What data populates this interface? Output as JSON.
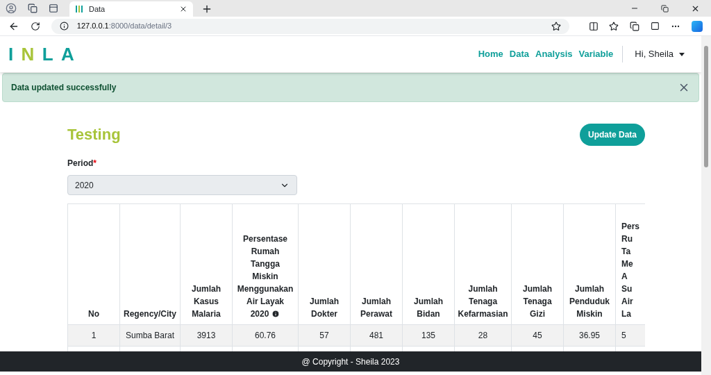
{
  "browser": {
    "tab_title": "Data",
    "url_host": "127.0.0.1",
    "url_path": ":8000/data/detail/3"
  },
  "navbar": {
    "logo": [
      {
        "text": "I",
        "color": "#0f9f9a"
      },
      {
        "text": "N",
        "color": "#a8c43a"
      },
      {
        "text": "L",
        "color": "#0f9f9a"
      },
      {
        "text": "A",
        "color": "#0f9f9a"
      }
    ],
    "links": [
      {
        "label": "Home"
      },
      {
        "label": "Data"
      },
      {
        "label": "Analysis"
      },
      {
        "label": "Variable"
      }
    ],
    "user": "Hi, Sheila"
  },
  "alert": {
    "message": "Data updated successfully",
    "dismissible": true
  },
  "page": {
    "title": "Testing",
    "action": "Update Data",
    "period": {
      "label": "Period",
      "required_mark": "*",
      "value": "2020"
    }
  },
  "table": {
    "columns": [
      {
        "lines": [
          "No"
        ]
      },
      {
        "lines": [
          "Regency/City"
        ]
      },
      {
        "lines": [
          "Jumlah",
          "Kasus",
          "Malaria"
        ]
      },
      {
        "lines": [
          "Persentase",
          "Rumah",
          "Tangga",
          "Miskin",
          "Menggunakan",
          "Air Layak",
          "2020"
        ],
        "info": true
      },
      {
        "lines": [
          "Jumlah",
          "Dokter"
        ]
      },
      {
        "lines": [
          "Jumlah",
          "Perawat"
        ]
      },
      {
        "lines": [
          "Jumlah",
          "Bidan"
        ]
      },
      {
        "lines": [
          "Jumlah",
          "Tenaga",
          "Kefarmasian"
        ]
      },
      {
        "lines": [
          "Jumlah",
          "Tenaga",
          "Gizi"
        ]
      },
      {
        "lines": [
          "Jumlah",
          "Penduduk",
          "Miskin"
        ]
      },
      {
        "lines": [
          "Pers",
          "Ru",
          "Ta",
          "Me",
          "A",
          "Su",
          "Air",
          "La"
        ],
        "cut": true
      }
    ],
    "rows": [
      [
        "1",
        "Sumba Barat",
        "3913",
        "60.76",
        "57",
        "481",
        "135",
        "28",
        "45",
        "36.95",
        "5"
      ]
    ]
  },
  "footer": "@ Copyright - Sheila 2023"
}
